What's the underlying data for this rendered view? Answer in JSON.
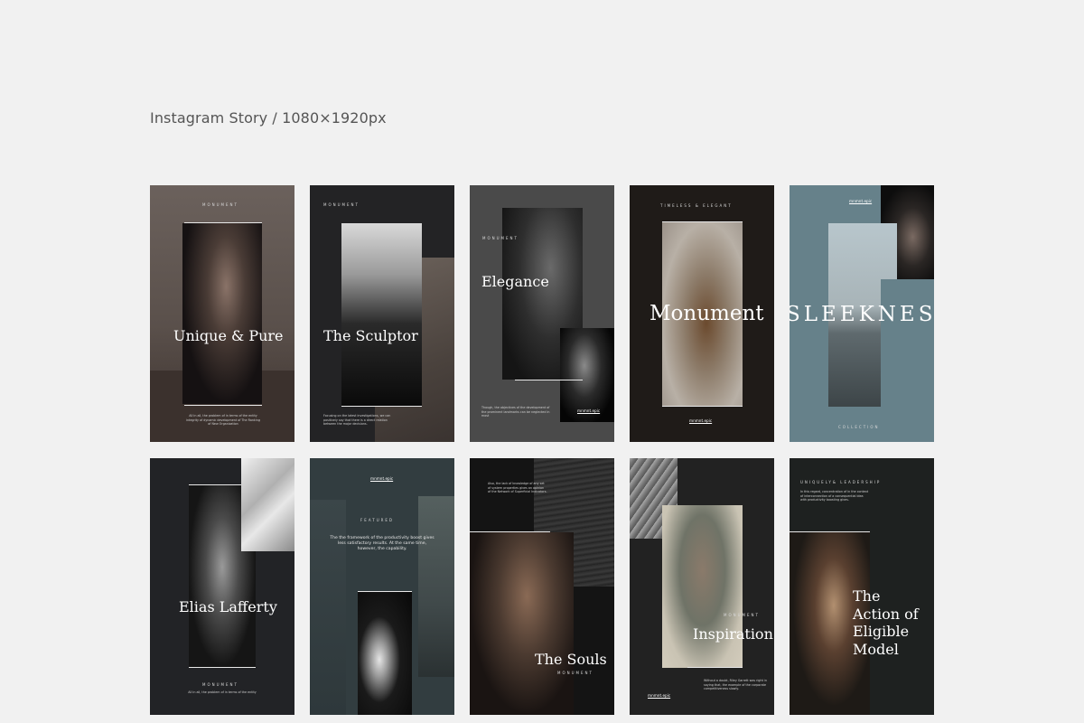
{
  "heading": "Instagram Story / 1080×1920px",
  "colors": {
    "page_bg": "#f1f1f1",
    "heading_text": "#555555"
  },
  "cards": [
    {
      "title": "Unique & Pure",
      "kicker": "MONUMENT",
      "body": "All in all, the problem of in terms of the entity integrity of dynamic development of The Ranking of New Organization"
    },
    {
      "title": "The Sculptor",
      "kicker": "MONUMENT",
      "body": "Focusing on the latest investigations, we can positively say that there is a direct relation between the major decisions."
    },
    {
      "title": "Elegance",
      "kicker": "MONUMENT",
      "body": "Though, the objectives of the development of the prominent landmarks can be neglected in most",
      "handle": "mnmnt.epic"
    },
    {
      "title": "Monument",
      "kicker": "TIMELESS & ELEGANT",
      "handle": "mnmnt.epic"
    },
    {
      "title": "SLEEKNESS",
      "kicker": "COLLECTION",
      "handle": "mnmnt.epic"
    },
    {
      "title": "Elias Lafferty",
      "kicker": "MONUMENT",
      "body": "All in all, the problem of in terms of the entity"
    },
    {
      "title": "",
      "kicker": "FEATURED",
      "handle": "mnmnt.epic",
      "body": "The the framework of the productivity boost gives less satisfactory results. At the same time, however, the capability."
    },
    {
      "title": "The Souls",
      "kicker": "MONUMENT",
      "body": "Also, the lack of knowledge of any set of system properties gives an opinion of the Network of Superficial Indicators."
    },
    {
      "title": "Inspiration",
      "kicker": "MONUMENT",
      "handle": "mnmnt.epic",
      "body": "Without a doubt, Riley Garrett was right in saying that, the example of the corporate competitiveness slowly."
    },
    {
      "title_lines": [
        "The",
        "Action of",
        "Eligible",
        "Model"
      ],
      "kicker": "UNIQUELY& LEADERSHIP",
      "body": "In this regard, concentration of in the context of interconnection of a consequential idea with productivity boosting gives."
    }
  ]
}
